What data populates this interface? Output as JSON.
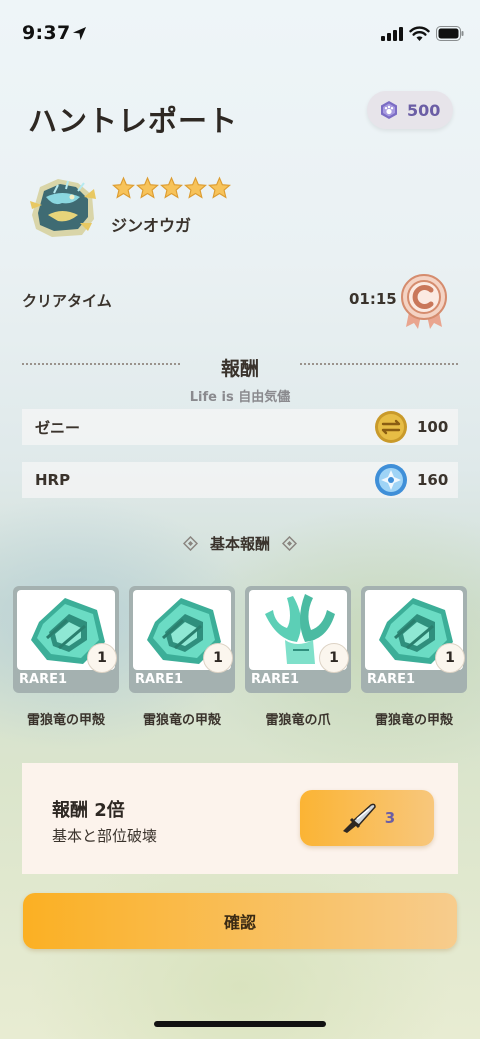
{
  "status_bar": {
    "time": "9:37"
  },
  "header": {
    "title": "ハントレポート",
    "currency_value": "500"
  },
  "monster": {
    "name": "ジンオウガ",
    "stars": 5
  },
  "clear": {
    "label": "クリアタイム",
    "time": "01:15",
    "rank": "C"
  },
  "rewards": {
    "title": "報酬",
    "overlay": "Life is 自由気儘",
    "rows": [
      {
        "label": "ゼニー",
        "icon": "zenny-coin-icon",
        "value": "100"
      },
      {
        "label": "HRP",
        "icon": "hrp-icon",
        "value": "160"
      }
    ],
    "basic_title": "基本報酬",
    "items": [
      {
        "name": "雷狼竜の甲殻",
        "rarity": "RARE1",
        "count": "1",
        "icon": "carapace-icon"
      },
      {
        "name": "雷狼竜の甲殻",
        "rarity": "RARE1",
        "count": "1",
        "icon": "carapace-icon"
      },
      {
        "name": "雷狼竜の爪",
        "rarity": "RARE1",
        "count": "1",
        "icon": "claw-icon"
      },
      {
        "name": "雷狼竜の甲殻",
        "rarity": "RARE1",
        "count": "1",
        "icon": "carapace-icon"
      }
    ]
  },
  "double_reward": {
    "title": "報酬 2倍",
    "subtitle": "基本と部位破壊",
    "ticket_count": "3"
  },
  "confirm_label": "確認",
  "colors": {
    "accent_orange": "#fbb023",
    "currency_purple": "#6b5ea5",
    "item_teal": "#5ccfb6",
    "card_bg": "#fcf3ec"
  }
}
